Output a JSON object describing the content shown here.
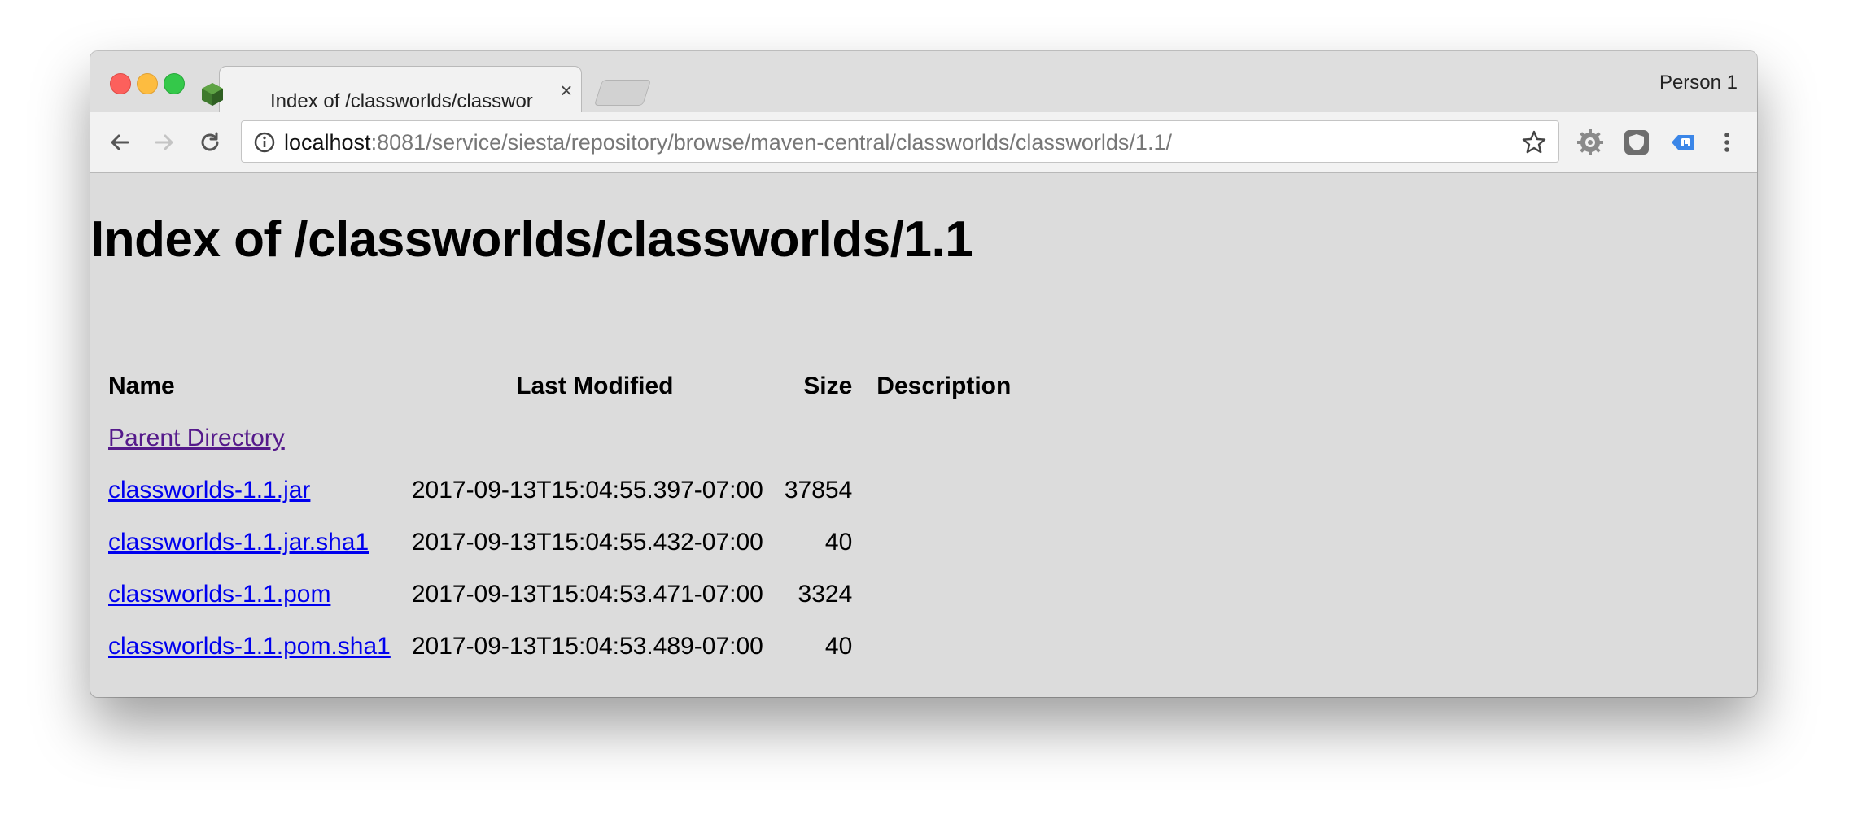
{
  "browser": {
    "tab_title": "Index of /classworlds/classwor",
    "profile_name": "Person 1",
    "url_host": "localhost",
    "url_rest": ":8081/service/siesta/repository/browse/maven-central/classworlds/classworlds/1.1/"
  },
  "page": {
    "heading": "Index of /classworlds/classworlds/1.1",
    "columns": {
      "name": "Name",
      "last_modified": "Last Modified",
      "size": "Size",
      "description": "Description"
    },
    "parent_link": "Parent Directory",
    "rows": [
      {
        "name": "classworlds-1.1.jar",
        "modified": "2017-09-13T15:04:55.397-07:00",
        "size": "37854"
      },
      {
        "name": "classworlds-1.1.jar.sha1",
        "modified": "2017-09-13T15:04:55.432-07:00",
        "size": "40"
      },
      {
        "name": "classworlds-1.1.pom",
        "modified": "2017-09-13T15:04:53.471-07:00",
        "size": "3324"
      },
      {
        "name": "classworlds-1.1.pom.sha1",
        "modified": "2017-09-13T15:04:53.489-07:00",
        "size": "40"
      }
    ]
  },
  "icons": {
    "favicon": "nexus-hexagon-icon",
    "back": "arrow-left-icon",
    "forward": "arrow-right-icon",
    "reload": "reload-icon",
    "info": "info-icon",
    "bookmark": "star-icon",
    "extensions": [
      "gear-extension-icon",
      "shield-extension-icon",
      "tag-extension-icon"
    ],
    "menu": "kebab-menu-icon"
  },
  "colors": {
    "link": "#0000ee",
    "visited_link": "#551a8b",
    "page_background": "#dcdcdc"
  }
}
